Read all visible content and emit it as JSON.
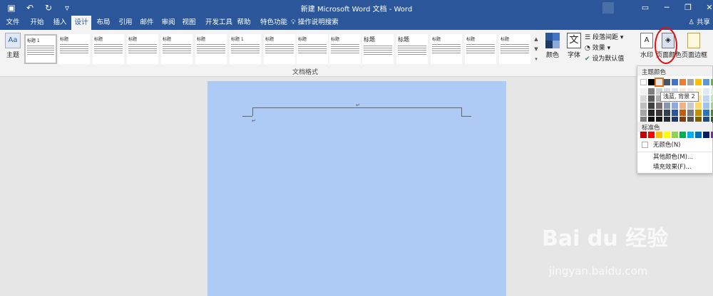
{
  "titlebar": {
    "title": "新建 Microsoft Word 文档 - Word",
    "color": "#2b579a",
    "qat_icons": [
      "save-icon",
      "undo-icon",
      "redo-icon",
      "customize-icon"
    ]
  },
  "tabs": [
    {
      "label": "文件",
      "active": false
    },
    {
      "label": "开始",
      "active": false
    },
    {
      "label": "插入",
      "active": false
    },
    {
      "label": "设计",
      "active": true
    },
    {
      "label": "布局",
      "active": false
    },
    {
      "label": "引用",
      "active": false
    },
    {
      "label": "邮件",
      "active": false
    },
    {
      "label": "审阅",
      "active": false
    },
    {
      "label": "视图",
      "active": false
    },
    {
      "label": "开发工具",
      "active": false
    },
    {
      "label": "帮助",
      "active": false
    },
    {
      "label": "特色功能",
      "active": false
    }
  ],
  "tell_me": "操作说明搜索",
  "share": "共享",
  "ribbon": {
    "theme_label": "主题",
    "style_gallery": [
      {
        "title": "标题 1",
        "big": false
      },
      {
        "title": "标题",
        "big": false
      },
      {
        "title": "标题",
        "big": false
      },
      {
        "title": "标题",
        "big": false
      },
      {
        "title": "标题",
        "big": false
      },
      {
        "title": "标题",
        "big": false
      },
      {
        "title": "标题 1",
        "big": false
      },
      {
        "title": "标题",
        "big": false
      },
      {
        "title": "标题",
        "big": false
      },
      {
        "title": "标题",
        "big": false
      },
      {
        "title": "标题",
        "big": true
      },
      {
        "title": "标题",
        "big": true
      },
      {
        "title": "标题",
        "big": false
      },
      {
        "title": "标题",
        "big": false
      },
      {
        "title": "标题",
        "big": false
      }
    ],
    "group_label": "文档格式",
    "colors_label": "颜色",
    "fonts_label": "字体",
    "paragraph_spacing": "段落间距",
    "effects": "效果",
    "set_default": "设为默认值",
    "watermark": "水印",
    "page_color": "页面颜色",
    "page_borders": "页面边框"
  },
  "page": {
    "background": "#aecbf6"
  },
  "page_color_menu": {
    "theme_colors_title": "主题颜色",
    "theme_colors": [
      [
        "#ffffff",
        "#000000",
        "#e7e6e6",
        "#44546a",
        "#4472c4",
        "#ed7d31",
        "#a5a5a5",
        "#ffc000",
        "#5b9bd5",
        "#70ad47"
      ],
      [
        "#f2f2f2",
        "#7f7f7f",
        "#d0cece",
        "#d6dce4",
        "#d9e2f3",
        "#fbe5d5",
        "#ededed",
        "#fff2cc",
        "#deebf6",
        "#e2efd9"
      ],
      [
        "#d8d8d8",
        "#595959",
        "#aeabab",
        "#adb9ca",
        "#b4c6e7",
        "#f7cbac",
        "#dbdbdb",
        "#fee599",
        "#bdd7ee",
        "#c5e0b3"
      ],
      [
        "#bfbfbf",
        "#3f3f3f",
        "#757070",
        "#8496b0",
        "#8eaadb",
        "#f4b183",
        "#c9c9c9",
        "#ffd965",
        "#9dc3e6",
        "#a8d08d"
      ],
      [
        "#a5a5a5",
        "#262626",
        "#3a3838",
        "#323f4f",
        "#2f5496",
        "#c55a11",
        "#7b7b7b",
        "#bf9000",
        "#2e75b5",
        "#538135"
      ],
      [
        "#7f7f7f",
        "#0c0c0c",
        "#171616",
        "#222a35",
        "#1f3864",
        "#833c0b",
        "#525252",
        "#7f6000",
        "#1e4e79",
        "#375623"
      ]
    ],
    "selected_theme_color": "#e7e6e6",
    "tooltip": "浅蓝, 背景 2",
    "standard_colors_title": "标准色",
    "standard_colors": [
      "#c00000",
      "#ff0000",
      "#ffc000",
      "#ffff00",
      "#92d050",
      "#00b050",
      "#00b0f0",
      "#0070c0",
      "#002060",
      "#7030a0"
    ],
    "no_color": "无颜色(N)",
    "more_colors": "其他颜色(M)...",
    "fill_effects": "填充效果(F)..."
  },
  "watermark_overlay": {
    "brand": "Bai du 经验",
    "sub": "jingyan.baidu.com"
  }
}
